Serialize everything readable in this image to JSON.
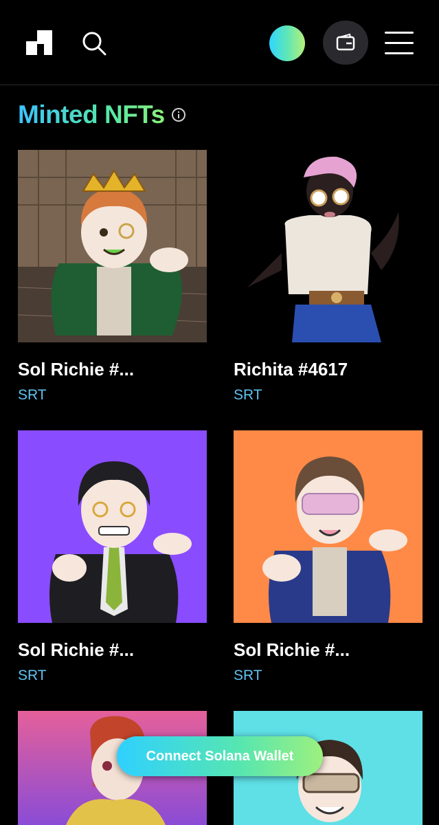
{
  "header": {
    "logo_icon": "brand-logo-icon",
    "search_icon": "search-icon",
    "avatar_icon": "gradient-avatar",
    "wallet_icon": "wallet-icon",
    "menu_icon": "hamburger-menu-icon"
  },
  "section": {
    "title": "Minted NFTs",
    "info_icon": "info-icon"
  },
  "nfts": [
    {
      "name": "Sol Richie #...",
      "symbol": "SRT",
      "image": "crowned-richie-staircase",
      "bg": "#6b5a4a"
    },
    {
      "name": "Richita #4617",
      "symbol": "SRT",
      "image": "richita-dark-figure",
      "bg": "#000000"
    },
    {
      "name": "Sol Richie #...",
      "symbol": "SRT",
      "image": "richie-suit-purple",
      "bg": "#8a4cff"
    },
    {
      "name": "Sol Richie #...",
      "symbol": "SRT",
      "image": "richie-goggles-orange",
      "bg": "#ff8a47"
    },
    {
      "name": "",
      "symbol": "",
      "image": "redhead-pink-gradient",
      "bg": "#e5609a"
    },
    {
      "name": "",
      "symbol": "",
      "image": "richie-glasses-cyan",
      "bg": "#5ee0e6"
    }
  ],
  "footer": {
    "connect_label": "Connect Solana Wallet"
  },
  "colors": {
    "accent_gradient_start": "#2fd0ff",
    "accent_gradient_end": "#9df07e",
    "symbol_text": "#5fc2f0"
  }
}
